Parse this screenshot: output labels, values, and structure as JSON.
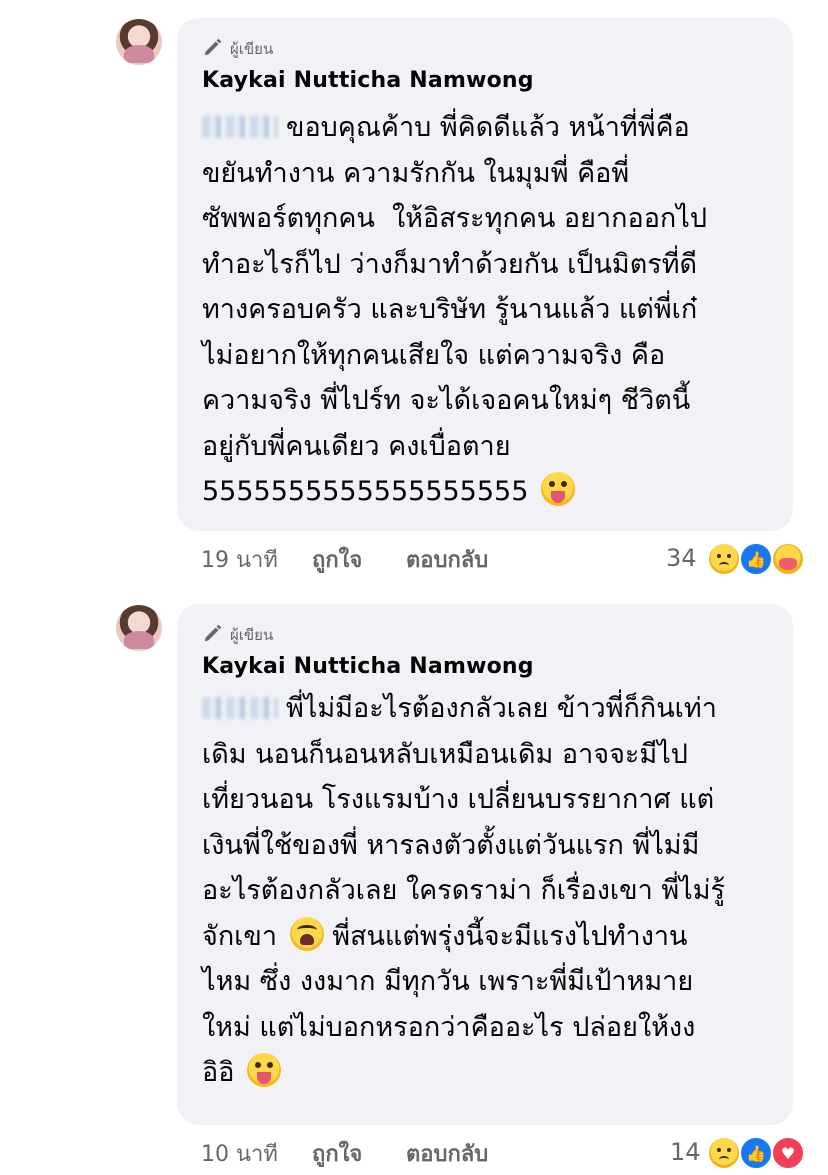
{
  "comments": [
    {
      "author_badge": "ผู้เขียน",
      "author_name": "Kaykai Nutticha Namwong",
      "text": "ขอบคุณค้าบ พี่คิดดีแล้ว หน้าที่พี่คือ\nขยันทำงาน ความรักกัน ในมุมพี่ คือพี่\nซัพพอร์ตทุกคน  ให้อิสระทุกคน อยากออกไป\nทำอะไรก็ไป ว่างก็มาทำด้วยกัน เป็นมิตรที่ดี\nทางครอบครัว และบริษัท รู้นานแล้ว แต่พี่เก๋\nไม่อยากให้ทุกคนเสียใจ แต่ความจริง คือ\nความจริง พี่ไปร์ท จะได้เจอคนใหม่ๆ ชีวิตนี้\nอยู่กับพี่คนเดียว คงเบื่อตาย\n5555555555555555555",
      "end_emoji": "tongue-emoji",
      "time": "19 นาที",
      "like_label": "ถูกใจ",
      "reply_label": "ตอบกลับ",
      "reaction_count": "34",
      "reactions": [
        "sad-reaction-icon",
        "like-reaction-icon",
        "care-reaction-icon"
      ]
    },
    {
      "author_badge": "ผู้เขียน",
      "author_name": "Kaykai Nutticha Namwong",
      "text_part1": "พี่ไม่มีอะไรต้องกลัวเลย ข้าวพี่ก็กินเท่า\nเดิม นอนก็นอนหลับเหมือนเดิม อาจจะมีไป\nเที่ยวนอน โรงแรมบ้าง เปลี่ยนบรรยากาศ แต่\nเงินพี่ใช้ของพี่ หารลงตัวตั้งแต่วันแรก พี่ไม่มี\nอะไรต้องกลัวเลย ใครดราม่า ก็เรื่องเขา พี่ไม่รู้\nจักเขา",
      "text_part2": " พี่สนแต่พรุ่งนี้จะมีแรงไปทำงาน\nไหม ซึ่ง งงมาก มีทุกวัน เพราะพี่มีเป้าหมาย\nใหม่ แต่ไม่บอกหรอกว่าคืออะไร ปล่อยให้งง\nอิอิ",
      "time": "10 นาที",
      "like_label": "ถูกใจ",
      "reply_label": "ตอบกลับ",
      "reaction_count": "14",
      "reactions": [
        "sad-reaction-icon",
        "like-reaction-icon",
        "love-reaction-icon"
      ]
    }
  ]
}
